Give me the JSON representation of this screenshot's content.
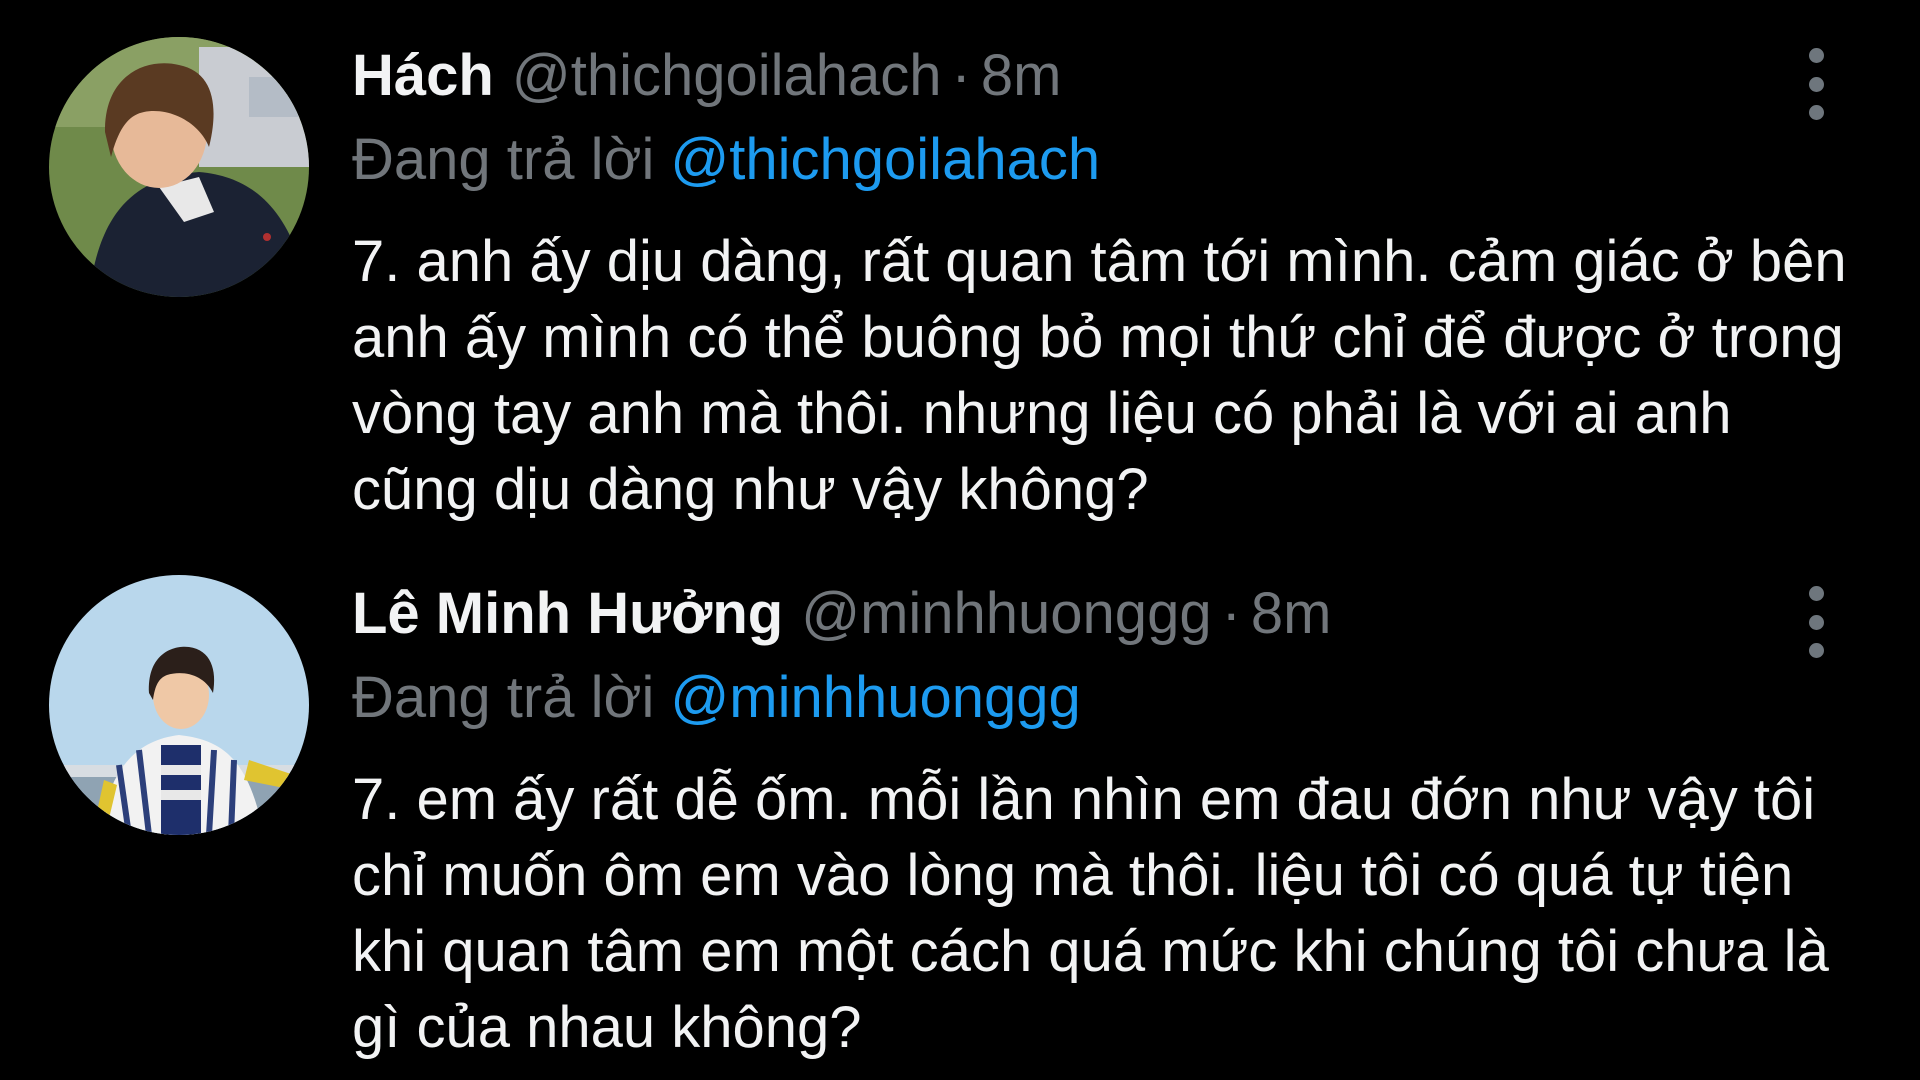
{
  "tweets": [
    {
      "display_name": "Hách",
      "handle": "@thichgoilahach",
      "separator": "·",
      "time": "8m",
      "reply_prefix": "Đang trả lời",
      "reply_to": "@thichgoilahach",
      "text": "7. anh ấy dịu dàng, rất quan tâm tới mình. cảm giác ở bên anh ấy mình có thể buông bỏ mọi thứ chỉ để được ở trong vòng tay anh mà thôi. nhưng liệu có phải là với ai anh cũng dịu dàng như vậy không?",
      "avatar_icon": "profile-photo-icon",
      "menu_icon": "more-vertical-icon"
    },
    {
      "display_name": "Lê Minh Hưởng",
      "handle": "@minhhuonggg",
      "separator": "·",
      "time": "8m",
      "reply_prefix": "Đang trả lời",
      "reply_to": "@minhhuonggg",
      "text": "7. em ấy rất dễ ốm. mỗi lần nhìn em đau đớn như vậy tôi chỉ muốn ôm em vào lòng mà thôi. liệu tôi có quá tự tiện khi quan tâm em một cách quá mức khi chúng tôi chưa là gì của nhau không?",
      "avatar_icon": "profile-photo-icon",
      "menu_icon": "more-vertical-icon"
    }
  ],
  "colors": {
    "background": "#000000",
    "primary_text": "#f2f3f4",
    "secondary_text": "#71767b",
    "accent": "#1d9bf0"
  }
}
